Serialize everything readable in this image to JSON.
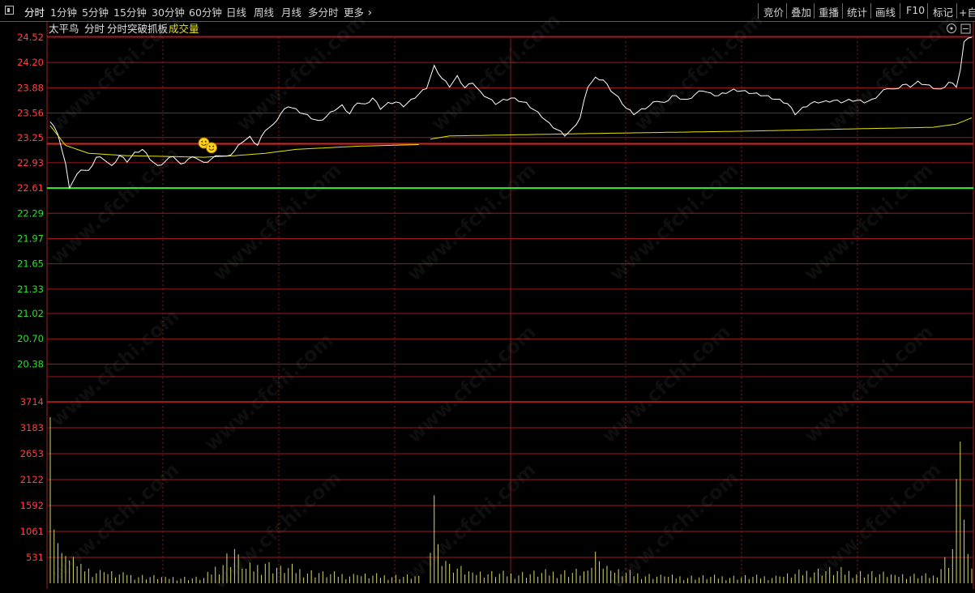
{
  "toolbar": {
    "left_items": [
      "分时",
      "1分钟",
      "5分钟",
      "15分钟",
      "30分钟",
      "60分钟",
      "日线",
      "周线",
      "月线",
      "多分时"
    ],
    "more_label": "更多",
    "right_items": [
      "竞价",
      "叠加",
      "重播",
      "统计",
      "画线",
      "F10",
      "标记",
      "+自"
    ]
  },
  "legend": {
    "stock_name": "太平鸟",
    "period": "分时",
    "indicator": "分时突破抓板",
    "volume_label": "成交量"
  },
  "watermark": "www.cfchi.com",
  "colors": {
    "price_line": "#ffffff",
    "avg_line": "#e6e600",
    "grid_red": "#a01818",
    "up_label": "#ff4040",
    "down_label": "#33dd33",
    "support_line": "#33ee33",
    "resistance_line": "#dd2222",
    "volume_bar": "#d8d86a"
  },
  "chart_data": {
    "type": "line",
    "price_axis": {
      "ticks": [
        "24.52",
        "24.20",
        "23.88",
        "23.56",
        "23.25",
        "22.93",
        "22.61",
        "22.29",
        "21.97",
        "21.65",
        "21.33",
        "21.02",
        "20.70",
        "20.38"
      ],
      "ylim": [
        20.22,
        24.52
      ],
      "prev_close": 22.45
    },
    "volume_axis": {
      "ticks": [
        "3714",
        "3183",
        "2653",
        "2122",
        "1592",
        "1061",
        "531"
      ],
      "ylim": [
        0,
        3714
      ]
    },
    "resistance_price": 23.17,
    "support_price": 22.61,
    "minutes": 240,
    "price_keypoints": [
      [
        0,
        23.45
      ],
      [
        2,
        23.3
      ],
      [
        4,
        22.9
      ],
      [
        5,
        22.62
      ],
      [
        6,
        22.7
      ],
      [
        8,
        22.85
      ],
      [
        10,
        22.82
      ],
      [
        12,
        23.0
      ],
      [
        14,
        22.98
      ],
      [
        16,
        22.88
      ],
      [
        18,
        23.02
      ],
      [
        20,
        22.95
      ],
      [
        22,
        23.05
      ],
      [
        24,
        23.1
      ],
      [
        26,
        22.98
      ],
      [
        28,
        22.88
      ],
      [
        30,
        22.95
      ],
      [
        32,
        23.02
      ],
      [
        34,
        22.9
      ],
      [
        36,
        22.98
      ],
      [
        38,
        23.0
      ],
      [
        40,
        22.92
      ],
      [
        42,
        22.98
      ],
      [
        44,
        23.03
      ],
      [
        46,
        23.0
      ],
      [
        48,
        23.08
      ],
      [
        50,
        23.2
      ],
      [
        52,
        23.25
      ],
      [
        54,
        23.15
      ],
      [
        56,
        23.35
      ],
      [
        58,
        23.4
      ],
      [
        60,
        23.55
      ],
      [
        62,
        23.65
      ],
      [
        64,
        23.6
      ],
      [
        66,
        23.55
      ],
      [
        68,
        23.5
      ],
      [
        70,
        23.45
      ],
      [
        72,
        23.52
      ],
      [
        74,
        23.6
      ],
      [
        76,
        23.65
      ],
      [
        78,
        23.55
      ],
      [
        80,
        23.7
      ],
      [
        82,
        23.66
      ],
      [
        84,
        23.75
      ],
      [
        86,
        23.62
      ],
      [
        88,
        23.68
      ],
      [
        90,
        23.7
      ],
      [
        92,
        23.65
      ],
      [
        94,
        23.72
      ],
      [
        96,
        23.8
      ],
      [
        98,
        23.88
      ],
      [
        100,
        24.15
      ],
      [
        102,
        24.0
      ],
      [
        104,
        23.9
      ],
      [
        106,
        24.02
      ],
      [
        108,
        23.88
      ],
      [
        110,
        23.95
      ],
      [
        112,
        23.82
      ],
      [
        114,
        23.75
      ],
      [
        116,
        23.68
      ],
      [
        118,
        23.72
      ],
      [
        120,
        23.75
      ],
      [
        122,
        23.72
      ],
      [
        124,
        23.68
      ],
      [
        126,
        23.6
      ],
      [
        128,
        23.52
      ],
      [
        130,
        23.42
      ],
      [
        132,
        23.35
      ],
      [
        134,
        23.28
      ],
      [
        136,
        23.35
      ],
      [
        138,
        23.5
      ],
      [
        140,
        23.9
      ],
      [
        142,
        24.0
      ],
      [
        144,
        23.98
      ],
      [
        146,
        23.85
      ],
      [
        148,
        23.75
      ],
      [
        150,
        23.62
      ],
      [
        152,
        23.55
      ],
      [
        154,
        23.6
      ],
      [
        156,
        23.65
      ],
      [
        158,
        23.72
      ],
      [
        160,
        23.68
      ],
      [
        162,
        23.78
      ],
      [
        164,
        23.75
      ],
      [
        166,
        23.72
      ],
      [
        168,
        23.8
      ],
      [
        170,
        23.85
      ],
      [
        172,
        23.8
      ],
      [
        174,
        23.78
      ],
      [
        176,
        23.82
      ],
      [
        178,
        23.85
      ],
      [
        180,
        23.84
      ],
      [
        182,
        23.82
      ],
      [
        184,
        23.8
      ],
      [
        186,
        23.78
      ],
      [
        188,
        23.75
      ],
      [
        190,
        23.72
      ],
      [
        192,
        23.68
      ],
      [
        194,
        23.55
      ],
      [
        196,
        23.62
      ],
      [
        198,
        23.68
      ],
      [
        200,
        23.7
      ],
      [
        202,
        23.7
      ],
      [
        204,
        23.72
      ],
      [
        206,
        23.7
      ],
      [
        208,
        23.72
      ],
      [
        210,
        23.72
      ],
      [
        212,
        23.7
      ],
      [
        214,
        23.72
      ],
      [
        216,
        23.8
      ],
      [
        218,
        23.88
      ],
      [
        220,
        23.85
      ],
      [
        222,
        23.92
      ],
      [
        224,
        23.9
      ],
      [
        226,
        23.95
      ],
      [
        228,
        23.92
      ],
      [
        230,
        23.88
      ],
      [
        232,
        23.85
      ],
      [
        234,
        23.95
      ],
      [
        236,
        23.9
      ],
      [
        237,
        24.1
      ],
      [
        238,
        24.45
      ],
      [
        239,
        24.52
      ],
      [
        240,
        24.52
      ]
    ],
    "avg_keypoints": [
      [
        0,
        23.4
      ],
      [
        4,
        23.15
      ],
      [
        10,
        23.05
      ],
      [
        20,
        23.02
      ],
      [
        40,
        23.0
      ],
      [
        48,
        23.02
      ],
      [
        56,
        23.05
      ],
      [
        64,
        23.1
      ],
      [
        80,
        23.14
      ],
      [
        96,
        23.16
      ],
      [
        98,
        23.16
      ],
      [
        99,
        23.23
      ],
      [
        104,
        23.27
      ],
      [
        140,
        23.3
      ],
      [
        180,
        23.33
      ],
      [
        230,
        23.38
      ],
      [
        236,
        23.42
      ],
      [
        240,
        23.5
      ]
    ],
    "vol_gap": [
      96,
      98
    ],
    "volume_keypoints": [
      [
        0,
        3400
      ],
      [
        1,
        1100
      ],
      [
        2,
        820
      ],
      [
        3,
        620
      ],
      [
        4,
        560
      ],
      [
        5,
        470
      ],
      [
        6,
        540
      ],
      [
        7,
        350
      ],
      [
        8,
        400
      ],
      [
        10,
        300
      ],
      [
        14,
        230
      ],
      [
        20,
        170
      ],
      [
        30,
        130
      ],
      [
        40,
        110
      ],
      [
        48,
        700
      ],
      [
        50,
        300
      ],
      [
        56,
        400
      ],
      [
        60,
        360
      ],
      [
        70,
        210
      ],
      [
        80,
        170
      ],
      [
        96,
        150
      ],
      [
        100,
        1800
      ],
      [
        101,
        800
      ],
      [
        104,
        400
      ],
      [
        106,
        300
      ],
      [
        110,
        220
      ],
      [
        120,
        200
      ],
      [
        140,
        260
      ],
      [
        142,
        650
      ],
      [
        143,
        450
      ],
      [
        146,
        260
      ],
      [
        160,
        140
      ],
      [
        190,
        140
      ],
      [
        200,
        300
      ],
      [
        220,
        170
      ],
      [
        230,
        160
      ],
      [
        235,
        700
      ],
      [
        237,
        2900
      ],
      [
        238,
        1300
      ],
      [
        239,
        600
      ],
      [
        240,
        300
      ]
    ]
  }
}
